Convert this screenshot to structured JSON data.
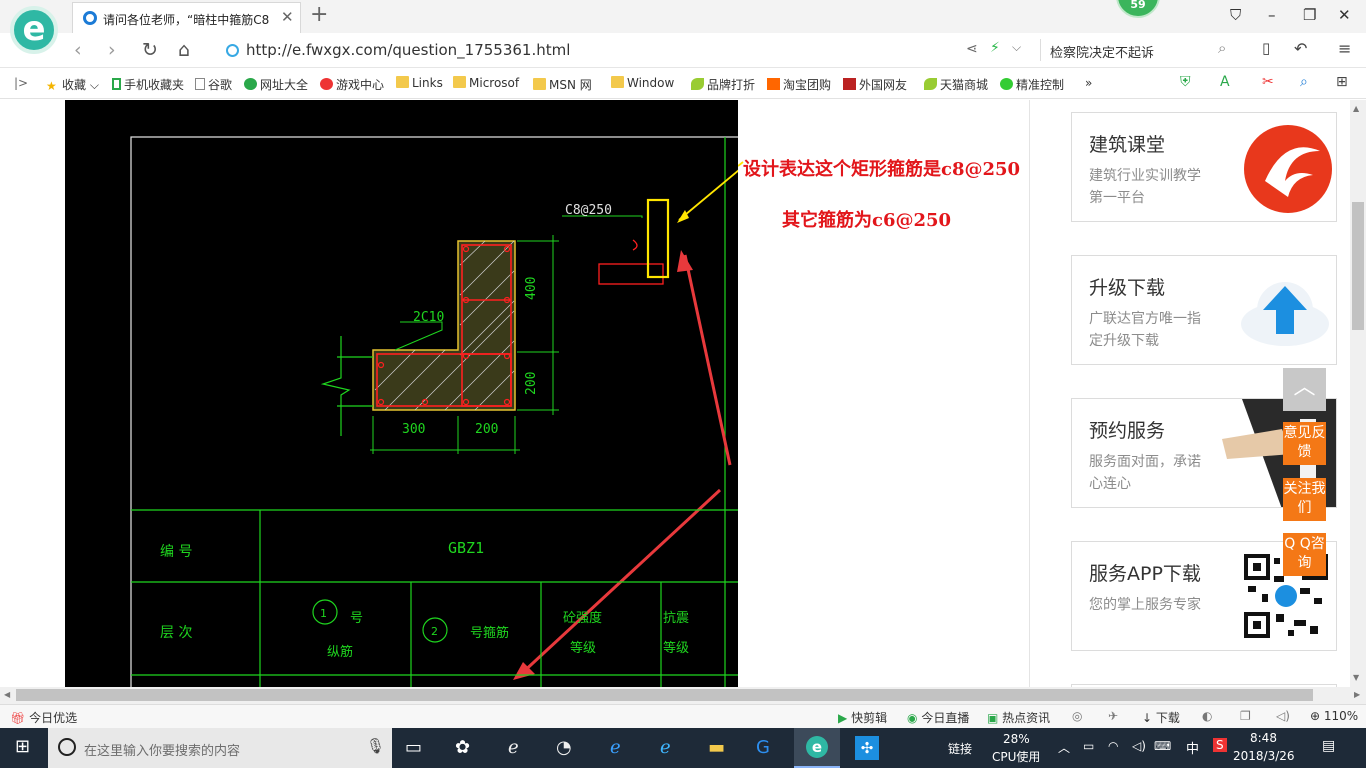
{
  "browser": {
    "tab_title": "请问各位老师，“暗柱中箍筋C8",
    "badge_count": "59",
    "url": "http://e.fwxgx.com/question_1755361.html",
    "search_hint": "检察院决定不起诉"
  },
  "bookmarks": {
    "items": [
      "收藏",
      "手机收藏夹",
      "谷歌",
      "网址大全",
      "游戏中心",
      "Links",
      "Microsof",
      "MSN 网",
      "Window",
      "品牌打折",
      "淘宝团购",
      "外国网友",
      "天猫商城",
      "精准控制"
    ],
    "more": "»"
  },
  "annotations": {
    "note1": "设计表达这个矩形箍筋是c8@250",
    "note2": "其它箍筋为c6@250"
  },
  "drawing": {
    "rebar_label": "C8@250",
    "bar_label": "2C10",
    "dims": {
      "d400": "400",
      "d200": "200",
      "d300": "300",
      "d200b": "200"
    },
    "table": {
      "col_no": "编 号",
      "code": "GBZ1",
      "row_level": "层 次",
      "c1_num": "1",
      "c1_label1": "号",
      "c1_label2": "纵筋",
      "c2_num": "2",
      "c2_label": "号箍筋",
      "c3_l1": "砼强度",
      "c3_l2": "等级",
      "c4_l1": "抗震",
      "c4_l2": "等级"
    }
  },
  "sidebar": {
    "cards": [
      {
        "title": "建筑课堂",
        "desc": "建筑行业实训教学第一平台"
      },
      {
        "title": "升级下载",
        "desc": "广联达官方唯一指定升级下载"
      },
      {
        "title": "预约服务",
        "desc": "服务面对面，承诺心连心"
      },
      {
        "title": "服务APP下载",
        "desc": "您的掌上服务专家"
      }
    ],
    "float": {
      "feedback": "意见反馈",
      "follow": "关注我们",
      "qq": "Q Q咨询"
    }
  },
  "statusbar": {
    "left": "今日优选",
    "items": [
      "快剪辑",
      "今日直播",
      "热点资讯",
      "下载"
    ],
    "zoom": "110%"
  },
  "taskbar": {
    "search_placeholder": "在这里输入你要搜索的内容",
    "link": "链接",
    "cpu_pct": "28%",
    "cpu_label": "CPU使用",
    "ime": "中",
    "time": "8:48",
    "date": "2018/3/26"
  },
  "colors": {
    "cad_green": "#1fd51f",
    "cad_red": "#ff2020",
    "note_red": "#e2161b",
    "accent_orange": "#f47816",
    "taskbar": "#1e2a38"
  }
}
